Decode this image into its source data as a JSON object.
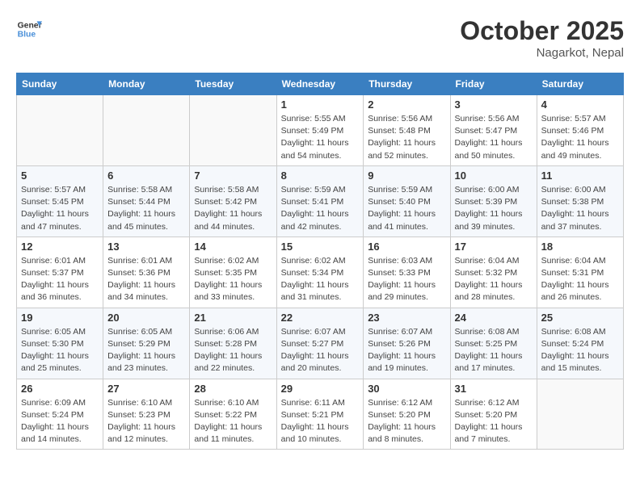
{
  "header": {
    "logo_line1": "General",
    "logo_line2": "Blue",
    "month": "October 2025",
    "location": "Nagarkot, Nepal"
  },
  "weekdays": [
    "Sunday",
    "Monday",
    "Tuesday",
    "Wednesday",
    "Thursday",
    "Friday",
    "Saturday"
  ],
  "weeks": [
    [
      {
        "day": "",
        "info": ""
      },
      {
        "day": "",
        "info": ""
      },
      {
        "day": "",
        "info": ""
      },
      {
        "day": "1",
        "info": "Sunrise: 5:55 AM\nSunset: 5:49 PM\nDaylight: 11 hours\nand 54 minutes."
      },
      {
        "day": "2",
        "info": "Sunrise: 5:56 AM\nSunset: 5:48 PM\nDaylight: 11 hours\nand 52 minutes."
      },
      {
        "day": "3",
        "info": "Sunrise: 5:56 AM\nSunset: 5:47 PM\nDaylight: 11 hours\nand 50 minutes."
      },
      {
        "day": "4",
        "info": "Sunrise: 5:57 AM\nSunset: 5:46 PM\nDaylight: 11 hours\nand 49 minutes."
      }
    ],
    [
      {
        "day": "5",
        "info": "Sunrise: 5:57 AM\nSunset: 5:45 PM\nDaylight: 11 hours\nand 47 minutes."
      },
      {
        "day": "6",
        "info": "Sunrise: 5:58 AM\nSunset: 5:44 PM\nDaylight: 11 hours\nand 45 minutes."
      },
      {
        "day": "7",
        "info": "Sunrise: 5:58 AM\nSunset: 5:42 PM\nDaylight: 11 hours\nand 44 minutes."
      },
      {
        "day": "8",
        "info": "Sunrise: 5:59 AM\nSunset: 5:41 PM\nDaylight: 11 hours\nand 42 minutes."
      },
      {
        "day": "9",
        "info": "Sunrise: 5:59 AM\nSunset: 5:40 PM\nDaylight: 11 hours\nand 41 minutes."
      },
      {
        "day": "10",
        "info": "Sunrise: 6:00 AM\nSunset: 5:39 PM\nDaylight: 11 hours\nand 39 minutes."
      },
      {
        "day": "11",
        "info": "Sunrise: 6:00 AM\nSunset: 5:38 PM\nDaylight: 11 hours\nand 37 minutes."
      }
    ],
    [
      {
        "day": "12",
        "info": "Sunrise: 6:01 AM\nSunset: 5:37 PM\nDaylight: 11 hours\nand 36 minutes."
      },
      {
        "day": "13",
        "info": "Sunrise: 6:01 AM\nSunset: 5:36 PM\nDaylight: 11 hours\nand 34 minutes."
      },
      {
        "day": "14",
        "info": "Sunrise: 6:02 AM\nSunset: 5:35 PM\nDaylight: 11 hours\nand 33 minutes."
      },
      {
        "day": "15",
        "info": "Sunrise: 6:02 AM\nSunset: 5:34 PM\nDaylight: 11 hours\nand 31 minutes."
      },
      {
        "day": "16",
        "info": "Sunrise: 6:03 AM\nSunset: 5:33 PM\nDaylight: 11 hours\nand 29 minutes."
      },
      {
        "day": "17",
        "info": "Sunrise: 6:04 AM\nSunset: 5:32 PM\nDaylight: 11 hours\nand 28 minutes."
      },
      {
        "day": "18",
        "info": "Sunrise: 6:04 AM\nSunset: 5:31 PM\nDaylight: 11 hours\nand 26 minutes."
      }
    ],
    [
      {
        "day": "19",
        "info": "Sunrise: 6:05 AM\nSunset: 5:30 PM\nDaylight: 11 hours\nand 25 minutes."
      },
      {
        "day": "20",
        "info": "Sunrise: 6:05 AM\nSunset: 5:29 PM\nDaylight: 11 hours\nand 23 minutes."
      },
      {
        "day": "21",
        "info": "Sunrise: 6:06 AM\nSunset: 5:28 PM\nDaylight: 11 hours\nand 22 minutes."
      },
      {
        "day": "22",
        "info": "Sunrise: 6:07 AM\nSunset: 5:27 PM\nDaylight: 11 hours\nand 20 minutes."
      },
      {
        "day": "23",
        "info": "Sunrise: 6:07 AM\nSunset: 5:26 PM\nDaylight: 11 hours\nand 19 minutes."
      },
      {
        "day": "24",
        "info": "Sunrise: 6:08 AM\nSunset: 5:25 PM\nDaylight: 11 hours\nand 17 minutes."
      },
      {
        "day": "25",
        "info": "Sunrise: 6:08 AM\nSunset: 5:24 PM\nDaylight: 11 hours\nand 15 minutes."
      }
    ],
    [
      {
        "day": "26",
        "info": "Sunrise: 6:09 AM\nSunset: 5:24 PM\nDaylight: 11 hours\nand 14 minutes."
      },
      {
        "day": "27",
        "info": "Sunrise: 6:10 AM\nSunset: 5:23 PM\nDaylight: 11 hours\nand 12 minutes."
      },
      {
        "day": "28",
        "info": "Sunrise: 6:10 AM\nSunset: 5:22 PM\nDaylight: 11 hours\nand 11 minutes."
      },
      {
        "day": "29",
        "info": "Sunrise: 6:11 AM\nSunset: 5:21 PM\nDaylight: 11 hours\nand 10 minutes."
      },
      {
        "day": "30",
        "info": "Sunrise: 6:12 AM\nSunset: 5:20 PM\nDaylight: 11 hours\nand 8 minutes."
      },
      {
        "day": "31",
        "info": "Sunrise: 6:12 AM\nSunset: 5:20 PM\nDaylight: 11 hours\nand 7 minutes."
      },
      {
        "day": "",
        "info": ""
      }
    ]
  ]
}
